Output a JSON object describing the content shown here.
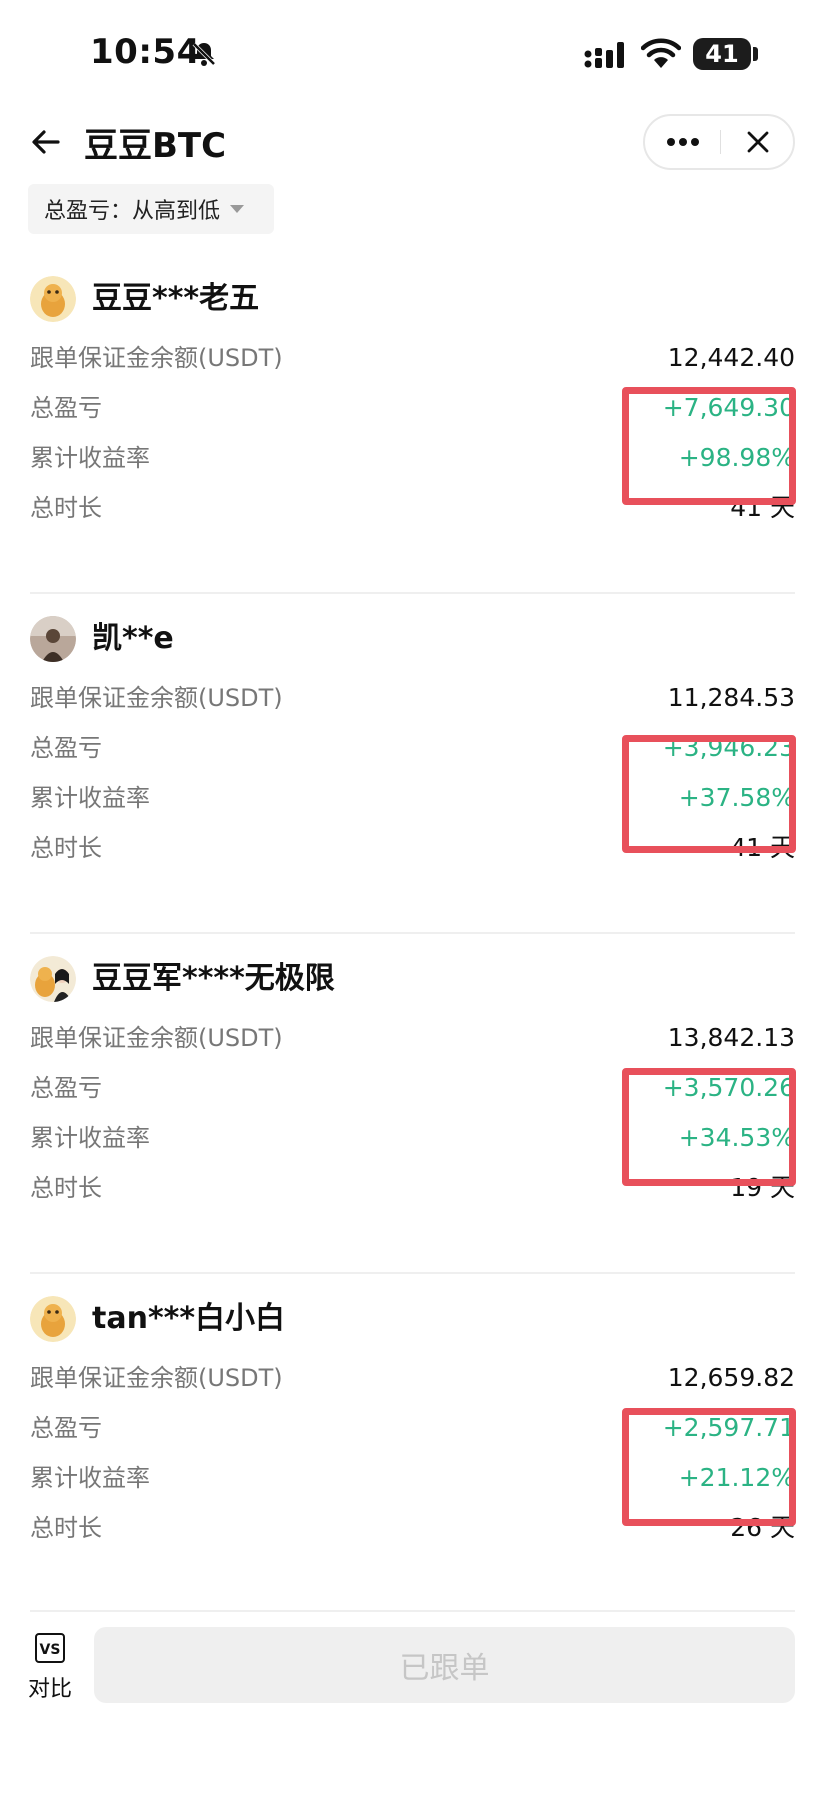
{
  "status_bar": {
    "time": "10:54",
    "battery": "41"
  },
  "header": {
    "title": "豆豆BTC"
  },
  "sort": {
    "label": "总盈亏：从高到低"
  },
  "traders": [
    {
      "name": "豆豆***老五",
      "margin_label": "跟单保证金余额(USDT)",
      "margin": "12,442.40",
      "pnl_label": "总盈亏",
      "pnl": "+7,649.30",
      "roi_label": "累计收益率",
      "roi": "+98.98%",
      "duration_label": "总时长",
      "duration": "41 天"
    },
    {
      "name": "凯**e",
      "margin_label": "跟单保证金余额(USDT)",
      "margin": "11,284.53",
      "pnl_label": "总盈亏",
      "pnl": "+3,946.23",
      "roi_label": "累计收益率",
      "roi": "+37.58%",
      "duration_label": "总时长",
      "duration": "41 天"
    },
    {
      "name": "豆豆军****无极限",
      "margin_label": "跟单保证金余额(USDT)",
      "margin": "13,842.13",
      "pnl_label": "总盈亏",
      "pnl": "+3,570.26",
      "roi_label": "累计收益率",
      "roi": "+34.53%",
      "duration_label": "总时长",
      "duration": "19 天"
    },
    {
      "name": "tan***白小白",
      "margin_label": "跟单保证金余额(USDT)",
      "margin": "12,659.82",
      "pnl_label": "总盈亏",
      "pnl": "+2,597.71",
      "roi_label": "累计收益率",
      "roi": "+21.12%",
      "duration_label": "总时长",
      "duration": "26 天"
    }
  ],
  "bottom": {
    "vs_icon": "VS",
    "compare_label": "对比",
    "followed_label": "已跟单"
  },
  "colors": {
    "positive": "#2bb384",
    "highlight_box": "#e8505b",
    "label": "#777777"
  },
  "icons": [
    "bell-slash-icon",
    "signal-icon",
    "wifi-icon",
    "battery-icon",
    "back-arrow-icon",
    "more-dots-icon",
    "close-icon",
    "caret-down-icon",
    "vs-icon"
  ]
}
